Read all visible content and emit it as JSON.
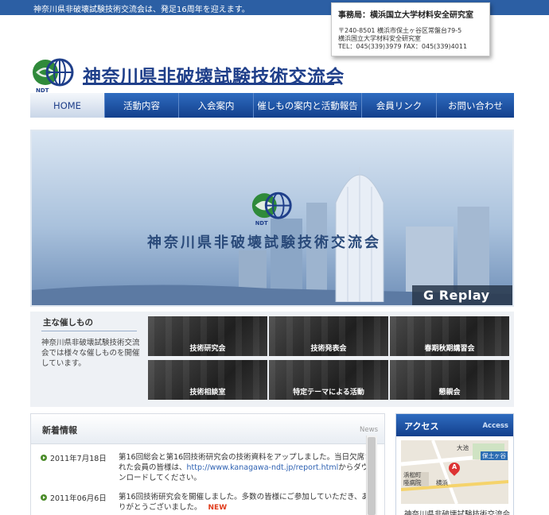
{
  "topbar": {
    "text": "神奈川県非破壊試験技術交流会は、発足16周年を迎えます。"
  },
  "contact": {
    "title": "事務局：横浜国立大学材料安全研究室",
    "lines": [
      "〒240-8501 横浜市保土ヶ谷区常盤台79-5",
      "横浜国立大学材料安全研究室",
      "TEL：045(339)3979 FAX：045(339)4011"
    ]
  },
  "logo": {
    "mark_letters": "NDT",
    "title": "神奈川県非破壊試験技術交流会"
  },
  "nav": {
    "items": [
      "HOME",
      "活動内容",
      "入会案内",
      "催しもの案内と活動報告",
      "会員リンク",
      "お問い合わせ"
    ]
  },
  "hero": {
    "title": "神奈川県非破壊試験技術交流会",
    "replay": "G Replay"
  },
  "events": {
    "heading": "主な催しもの",
    "description": "神奈川県非破壊試験技術交流会では様々な催しものを開催しています。",
    "tiles": [
      "技術研究会",
      "技術発表会",
      "春期秋期講習会",
      "技術相談室",
      "特定テーマによる活動",
      "懇親会"
    ]
  },
  "news": {
    "title": "新着情報",
    "tag": "News",
    "items": [
      {
        "date": "2011年7月18日",
        "text_before": "第16回総会と第16回技術研究会の技術資料をアップしました。当日欠席された会員の皆様は、",
        "link": "http://www.kanagawa-ndt.jp/report.html",
        "text_after": "からダウンロードしてください。",
        "new": ""
      },
      {
        "date": "2011年06月6日",
        "text_before": "第16回技術研究会を開催しました。多数の皆様にご参加していただき、ありがとうございました。",
        "link": "",
        "text_after": "",
        "new": "NEW"
      }
    ]
  },
  "access": {
    "title": "アクセス",
    "sub": "Access",
    "map_labels": [
      "大池",
      "保土ヶ谷",
      "浜松町",
      "陸病院",
      "横浜"
    ],
    "pin_letter": "A",
    "caption": "神奈川県非破壊試験技術交流会"
  }
}
